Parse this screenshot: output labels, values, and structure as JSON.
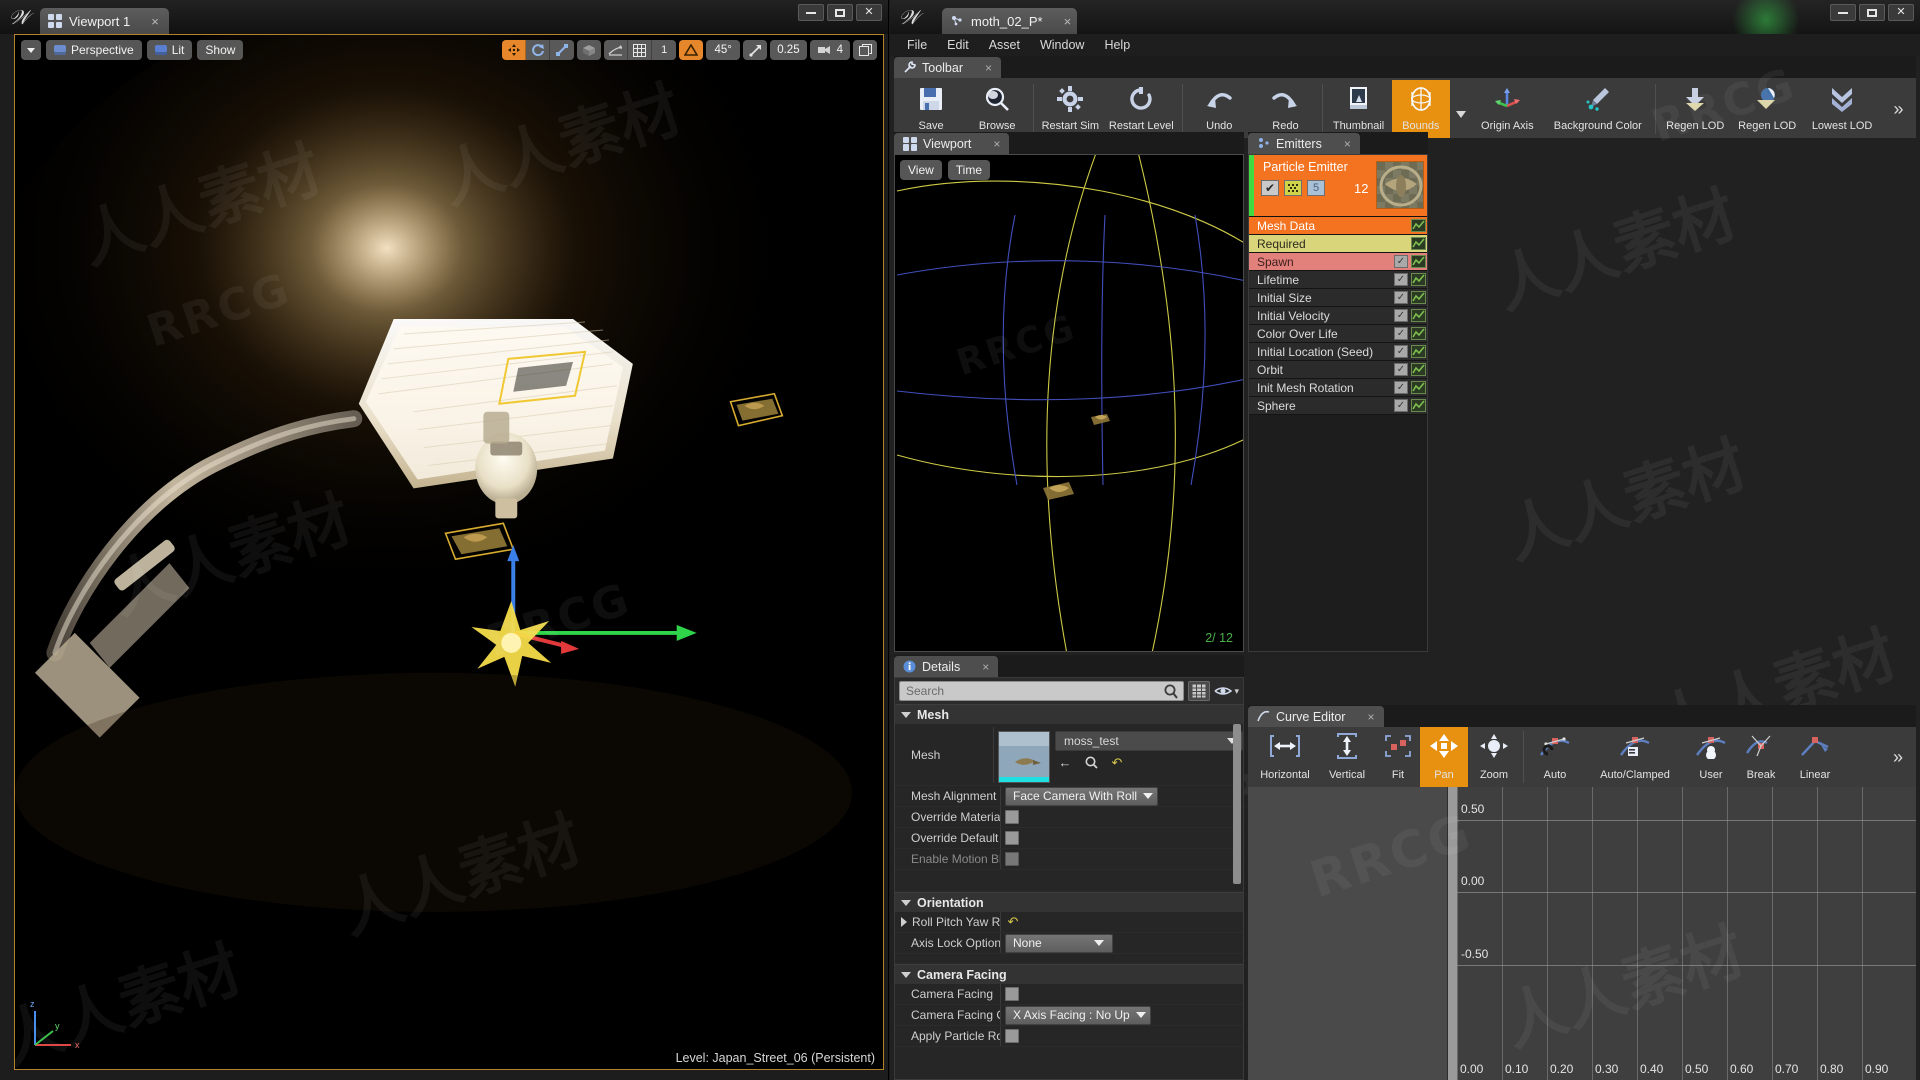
{
  "left_window": {
    "tab_label": "Viewport 1",
    "tab_close": "×",
    "window_buttons": {
      "minimize": "–",
      "maximize": "□",
      "close": "✕"
    },
    "toolbar": {
      "menu_caret": "▾",
      "perspective": "Perspective",
      "lit": "Lit",
      "show": "Show",
      "transform_modes": [
        "move-gizmo",
        "rotate-gizmo",
        "scale-gizmo"
      ],
      "coord_space": "world-space-icon",
      "surface_snap": "surface-snap-icon",
      "grid_snap": "grid-snap-icon",
      "grid_size": "1",
      "rotation_snap_icon": "angle-icon",
      "rotation_snap": "45°",
      "scale_snap_icon": "scale-arrow-icon",
      "scale_snap": "0.25",
      "camera_speed_icon": "camera-speed-icon",
      "camera_speed": "4",
      "maximize_icon": "maximize-viewport-icon"
    },
    "status": "Level:  Japan_Street_06 (Persistent)"
  },
  "right_window": {
    "tab_label": "moth_02_P*",
    "tab_close": "×",
    "window_buttons": {
      "minimize": "–",
      "maximize": "□",
      "close": "✕"
    },
    "menus": [
      "File",
      "Edit",
      "Asset",
      "Window",
      "Help"
    ],
    "toolbar_panel": {
      "tab_label": "Toolbar",
      "tab_close": "×",
      "overflow": "»",
      "items": [
        {
          "label": "Save",
          "icon": "save-disk-icon",
          "active": false,
          "group": 0
        },
        {
          "label": "Browse",
          "icon": "magnifier-icon",
          "active": false,
          "group": 0
        },
        {
          "label": "Restart Sim",
          "icon": "gear-icon",
          "active": false,
          "group": 1
        },
        {
          "label": "Restart Level",
          "icon": "refresh-icon",
          "active": false,
          "group": 1
        },
        {
          "label": "Undo",
          "icon": "undo-arrow-icon",
          "active": false,
          "group": 2
        },
        {
          "label": "Redo",
          "icon": "redo-arrow-icon",
          "active": false,
          "group": 2
        },
        {
          "label": "Thumbnail",
          "icon": "thumbnail-icon",
          "active": false,
          "group": 3
        },
        {
          "label": "Bounds",
          "icon": "bounds-icon",
          "active": true,
          "group": 3,
          "has_dropdown": true
        },
        {
          "label": "Origin Axis",
          "icon": "origin-axis-icon",
          "active": false,
          "group": 4
        },
        {
          "label": "Background Color",
          "icon": "background-color-icon",
          "active": false,
          "group": 4
        },
        {
          "label": "Regen LOD",
          "icon": "regen-lod-down-icon",
          "active": false,
          "group": 5
        },
        {
          "label": "Regen LOD",
          "icon": "regen-lod-dup-icon",
          "active": false,
          "group": 5
        },
        {
          "label": "Lowest LOD",
          "icon": "lowest-lod-icon",
          "active": false,
          "group": 5
        }
      ]
    },
    "viewport_panel": {
      "tab_label": "Viewport",
      "tab_close": "×",
      "view_button": "View",
      "time_button": "Time",
      "particle_count": "2/ 12"
    },
    "emitters_panel": {
      "tab_label": "Emitters",
      "tab_close": "×",
      "emitter": {
        "name": "Particle Emitter",
        "count": "12",
        "enabled_checkbox": "✔",
        "solo_icon": "solo-grid-icon",
        "level_badge": "5",
        "thumbnail": "emitter-thumbnail"
      },
      "modules": [
        {
          "name": "Mesh Data",
          "style": "c-orange",
          "checkbox": false,
          "curve": true
        },
        {
          "name": "Required",
          "style": "c-yellow",
          "checkbox": false,
          "curve": true
        },
        {
          "name": "Spawn",
          "style": "c-red",
          "checkbox": true,
          "curve": true
        },
        {
          "name": "Lifetime",
          "style": "c-dark",
          "checkbox": true,
          "curve": true
        },
        {
          "name": "Initial Size",
          "style": "c-dark",
          "checkbox": true,
          "curve": true
        },
        {
          "name": "Initial Velocity",
          "style": "c-dark",
          "checkbox": true,
          "curve": true
        },
        {
          "name": "Color Over Life",
          "style": "c-dark",
          "checkbox": true,
          "curve": true
        },
        {
          "name": "Initial Location (Seed)",
          "style": "c-dark",
          "checkbox": true,
          "curve": true
        },
        {
          "name": "Orbit",
          "style": "c-dark",
          "checkbox": true,
          "curve": true
        },
        {
          "name": "Init Mesh Rotation",
          "style": "c-dark",
          "checkbox": true,
          "curve": true
        },
        {
          "name": "Sphere",
          "style": "c-dark",
          "checkbox": true,
          "curve": true
        }
      ]
    },
    "details_panel": {
      "tab_label": "Details",
      "tab_close": "×",
      "search_placeholder": "Search",
      "search_value": "",
      "search_icon": "magnifier-icon",
      "grid_view_icon": "grid-view-icon",
      "eye_icon": "eye-icon",
      "eye_caret": "▾",
      "sections": [
        {
          "title": "Mesh",
          "rows": [
            {
              "label": "Mesh",
              "type": "asset",
              "value": "moss_test",
              "actions": [
                "back-arrow-icon",
                "browse-icon",
                "reset-icon"
              ]
            },
            {
              "label": "Mesh Alignment",
              "type": "combo",
              "value": "Face Camera With Roll"
            },
            {
              "label": "Override Material",
              "type": "checkbox",
              "value": false
            },
            {
              "label": "Override Default M…",
              "type": "checkbox",
              "value": false
            },
            {
              "label": "Enable Motion Blur",
              "type": "checkbox",
              "value": false,
              "disabled": true
            }
          ]
        },
        {
          "title": "Orientation",
          "rows": [
            {
              "label": "Roll Pitch Yaw Ran…",
              "type": "expand-reset",
              "value": "reset-icon"
            },
            {
              "label": "Axis Lock Option",
              "type": "combo",
              "value": "None"
            }
          ]
        },
        {
          "title": "Camera Facing",
          "rows": [
            {
              "label": "Camera Facing",
              "type": "checkbox",
              "value": false
            },
            {
              "label": "Camera Facing Opt…",
              "type": "combo",
              "value": "X Axis Facing : No Up"
            },
            {
              "label": "Apply Particle Rota…",
              "type": "checkbox",
              "value": false
            }
          ]
        }
      ]
    },
    "curve_editor": {
      "tab_label": "Curve Editor",
      "tab_close": "×",
      "overflow": "»",
      "tools": [
        {
          "label": "Horizontal",
          "icon": "fit-horizontal-icon",
          "active": false,
          "group": 0
        },
        {
          "label": "Vertical",
          "icon": "fit-vertical-icon",
          "active": false,
          "group": 0
        },
        {
          "label": "Fit",
          "icon": "fit-all-icon",
          "active": false,
          "group": 0
        },
        {
          "label": "Pan",
          "icon": "pan-icon",
          "active": true,
          "group": 1
        },
        {
          "label": "Zoom",
          "icon": "zoom-icon",
          "active": false,
          "group": 1
        },
        {
          "label": "Auto",
          "icon": "tangent-auto-icon",
          "active": false,
          "group": 2
        },
        {
          "label": "Auto/Clamped",
          "icon": "tangent-auto-clamped-icon",
          "active": false,
          "group": 2
        },
        {
          "label": "User",
          "icon": "tangent-user-icon",
          "active": false,
          "group": 2
        },
        {
          "label": "Break",
          "icon": "tangent-break-icon",
          "active": false,
          "group": 2
        },
        {
          "label": "Linear",
          "icon": "tangent-linear-icon",
          "active": false,
          "group": 2
        }
      ]
    }
  },
  "chart_data": {
    "type": "line",
    "title": "Curve Editor",
    "xlabel": "",
    "ylabel": "",
    "series": [],
    "x_ticks": [
      "0.00",
      "0.10",
      "0.20",
      "0.30",
      "0.40",
      "0.50",
      "0.60",
      "0.70",
      "0.80",
      "0.90"
    ],
    "y_ticks": [
      "0.50",
      "0.00",
      "-0.50"
    ],
    "xlim": [
      0.0,
      0.95
    ],
    "ylim": [
      -0.75,
      0.75
    ],
    "grid": true,
    "legend": "none"
  },
  "watermarks": {
    "chinese": "人人素材",
    "english": "RRCG"
  },
  "colors": {
    "accent_orange": "#e8900f",
    "emitter_orange": "#f37321",
    "required_yellow": "#d8d57a",
    "spawn_red": "#e2817c",
    "enabled_green": "#3fdb3f",
    "viewport_border": "#b4832a"
  }
}
